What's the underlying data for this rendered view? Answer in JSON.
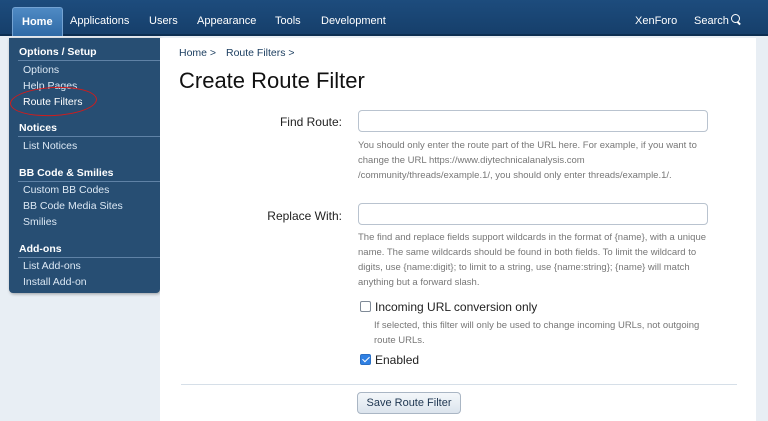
{
  "topnav": {
    "tabs": [
      "Home",
      "Applications",
      "Users",
      "Appearance",
      "Tools",
      "Development"
    ],
    "right": [
      "XenForo",
      "Search"
    ]
  },
  "sidebar": {
    "groups": [
      {
        "title": "Options / Setup",
        "items": [
          "Options",
          "Help Pages",
          "Route Filters"
        ]
      },
      {
        "title": "Notices",
        "items": [
          "List Notices"
        ]
      },
      {
        "title": "BB Code & Smilies",
        "items": [
          "Custom BB Codes",
          "BB Code Media Sites",
          "Smilies"
        ]
      },
      {
        "title": "Add-ons",
        "items": [
          "List Add-ons",
          "Install Add-on"
        ]
      }
    ]
  },
  "breadcrumb": [
    "Home >",
    "Route Filters >"
  ],
  "page_title": "Create Route Filter",
  "form": {
    "find_label": "Find Route:",
    "find_value": "",
    "find_hint": "You should only enter the route part of the URL here. For example, if you want to change the URL https://www.diytechnicalanalysis.com /community/threads/example.1/, you should only enter threads/example.1/.",
    "replace_label": "Replace With:",
    "replace_value": "",
    "replace_hint": "The find and replace fields support wildcards in the format of {name}, with a unique name. The same wildcards should be found in both fields. To limit the wildcard to digits, use {name:digit}; to limit to a string, use {name:string}; {name} will match anything but a forward slash.",
    "incoming_label": "Incoming URL conversion only",
    "incoming_hint": "If selected, this filter will only be used to change incoming URLs, not outgoing route URLs.",
    "enabled_label": "Enabled",
    "save_label": "Save Route Filter"
  },
  "colors": {
    "accent": "#2f6aa6",
    "annotation": "#d01c1c"
  }
}
